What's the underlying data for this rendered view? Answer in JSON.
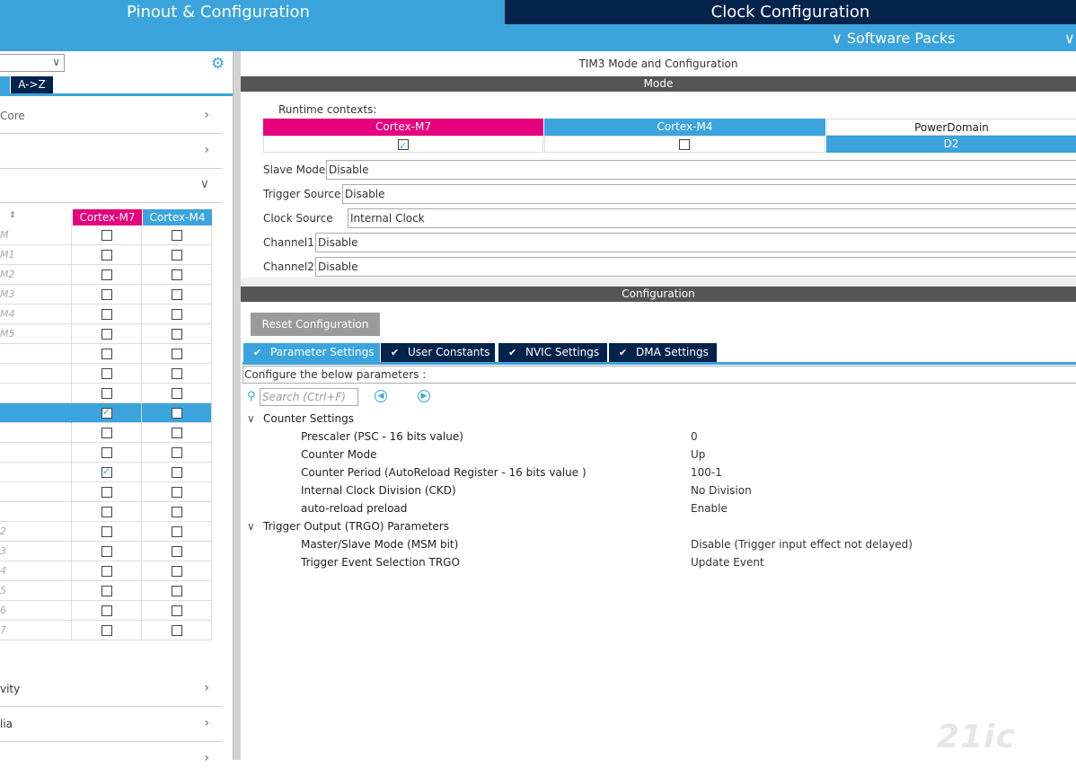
{
  "tabs": {
    "pinout": "Pinout & Configuration",
    "clock": "Clock Configuration"
  },
  "software_packs": "Software Packs",
  "left": {
    "az_label": "A->Z",
    "categories": [
      {
        "label": "Core"
      },
      {
        "label": ""
      },
      {
        "label": ""
      }
    ],
    "table_headers": {
      "m7": "Cortex-M7",
      "m4": "Cortex-M4"
    },
    "rows": [
      {
        "name": "M",
        "m7": false,
        "m4": false
      },
      {
        "name": "M1",
        "m7": false,
        "m4": false
      },
      {
        "name": "M2",
        "m7": false,
        "m4": false
      },
      {
        "name": "M3",
        "m7": false,
        "m4": false
      },
      {
        "name": "M4",
        "m7": false,
        "m4": false
      },
      {
        "name": "M5",
        "m7": false,
        "m4": false
      },
      {
        "name": "",
        "m7": false,
        "m4": false
      },
      {
        "name": "",
        "m7": false,
        "m4": false
      },
      {
        "name": "",
        "m7": false,
        "m4": false
      },
      {
        "name": "",
        "m7": true,
        "m4": false,
        "selected": true
      },
      {
        "name": "",
        "m7": false,
        "m4": false
      },
      {
        "name": "",
        "m7": false,
        "m4": false
      },
      {
        "name": "",
        "m7": true,
        "m4": false
      },
      {
        "name": "",
        "m7": false,
        "m4": false
      },
      {
        "name": "",
        "m7": false,
        "m4": false
      },
      {
        "name": "2",
        "m7": false,
        "m4": false
      },
      {
        "name": "3",
        "m7": false,
        "m4": false
      },
      {
        "name": "4",
        "m7": false,
        "m4": false
      },
      {
        "name": "5",
        "m7": false,
        "m4": false
      },
      {
        "name": "6",
        "m7": false,
        "m4": false
      },
      {
        "name": "7",
        "m7": false,
        "m4": false
      }
    ],
    "bottom_categories": [
      {
        "label": "vity"
      },
      {
        "label": "lia"
      },
      {
        "label": ""
      }
    ]
  },
  "right": {
    "title": "TIM3 Mode and Configuration",
    "mode_bar": "Mode",
    "runtime_label": "Runtime contexts:",
    "contexts": {
      "m7": "Cortex-M7",
      "m4": "Cortex-M4",
      "power": "PowerDomain",
      "power_value": "D2"
    },
    "mode_rows": [
      {
        "label": "Slave Mode",
        "value": "Disable"
      },
      {
        "label": "Trigger Source",
        "value": "Disable"
      },
      {
        "label": "Clock Source",
        "value": "Internal Clock"
      },
      {
        "label": "Channel1",
        "value": "Disable"
      },
      {
        "label": "Channel2",
        "value": "Disable"
      }
    ],
    "config_bar": "Configuration",
    "reset_button": "Reset Configuration",
    "param_tabs": [
      "Parameter Settings",
      "User Constants",
      "NVIC Settings",
      "DMA Settings"
    ],
    "configure_hint": "Configure the below parameters :",
    "search_placeholder": "Search (Ctrl+F)",
    "groups": [
      {
        "name": "Counter Settings",
        "params": [
          {
            "label": "Prescaler (PSC - 16 bits value)",
            "value": "0"
          },
          {
            "label": "Counter Mode",
            "value": "Up"
          },
          {
            "label": "Counter Period (AutoReload Register - 16 bits value )",
            "value": "100-1"
          },
          {
            "label": "Internal Clock Division (CKD)",
            "value": "No Division"
          },
          {
            "label": "auto-reload preload",
            "value": "Enable"
          }
        ]
      },
      {
        "name": "Trigger Output (TRGO) Parameters",
        "params": [
          {
            "label": "Master/Slave Mode (MSM bit)",
            "value": "Disable (Trigger input effect not delayed)"
          },
          {
            "label": "Trigger Event Selection TRGO",
            "value": "Update Event"
          }
        ]
      }
    ]
  },
  "watermark": "21ic",
  "colors": {
    "accent": "#3ba4dc",
    "navy": "#03234b",
    "m7": "#e6007e",
    "bar": "#555555"
  }
}
